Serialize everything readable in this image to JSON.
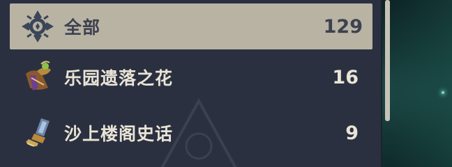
{
  "categories": [
    {
      "label": "全部",
      "count": "129",
      "icon": "all-category-emblem-icon",
      "selected": true
    },
    {
      "label": "乐园遗落之花",
      "count": "16",
      "icon": "flower-artifact-icon",
      "selected": false
    },
    {
      "label": "沙上楼阁史话",
      "count": "9",
      "icon": "hourglass-artifact-icon",
      "selected": false
    }
  ],
  "colors": {
    "panel": "#2b3040",
    "selected_row": "#b9b3a4",
    "text_light": "#e9e4d6",
    "text_dark": "#3d4150",
    "background": "#133634"
  }
}
